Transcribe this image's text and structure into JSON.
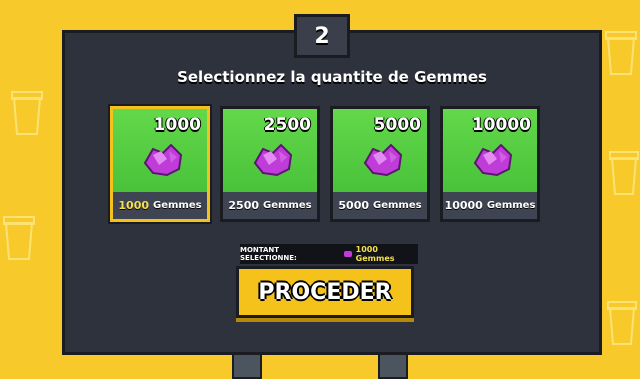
{
  "step": "2",
  "title": "Selectionnez la quantite de Gemmes",
  "unit": "Gemmes",
  "cards": [
    {
      "amount": "1000",
      "label": "1000",
      "selected": true
    },
    {
      "amount": "2500",
      "label": "2500",
      "selected": false
    },
    {
      "amount": "5000",
      "label": "5000",
      "selected": false
    },
    {
      "amount": "10000",
      "label": "10000",
      "selected": false
    }
  ],
  "selection": {
    "prefix": "MONTANT SELECTIONNE:",
    "value": "1000 Gemmes"
  },
  "proceed_label": "PROCEDER",
  "colors": {
    "background": "#f7c92a",
    "panel": "#2e323d",
    "card_green": "#55cc40",
    "gem": "#c03cd8",
    "button": "#f4c21b"
  }
}
